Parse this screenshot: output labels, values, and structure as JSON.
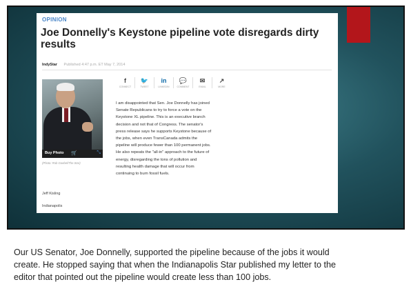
{
  "colors": {
    "slide_bg": "#21525d",
    "accent": "#b3161b",
    "opinion_label": "#4a86c8",
    "twitter": "#1da1f2",
    "linkedin": "#0e6aa8"
  },
  "article": {
    "section": "OPINION",
    "headline": "Joe Donnelly's Keystone pipeline vote disregards dirty results",
    "publisher": "IndyStar",
    "published": "Published 4:47 p.m. ET May 7, 2014",
    "share": [
      {
        "icon": "facebook-icon",
        "glyph": "f",
        "label": "CONNECT"
      },
      {
        "icon": "twitter-icon",
        "glyph": "🐦",
        "label": "TWEET"
      },
      {
        "icon": "linkedin-icon",
        "glyph": "in",
        "label": "LINKEDIN"
      },
      {
        "icon": "comment-icon",
        "glyph": "💬",
        "label": "COMMENT"
      },
      {
        "icon": "email-icon",
        "glyph": "✉",
        "label": "EMAIL"
      },
      {
        "icon": "more-icon",
        "glyph": "↗",
        "label": "MORE"
      }
    ],
    "photo": {
      "buy_label": "Buy Photo",
      "caption": "(Photo: Rob Goebel/The Star)"
    },
    "body_lines": [
      "I am disappointed that Sen. Joe Donnelly has joined",
      "Senate Republicans to try to force a vote on the",
      "Keystone XL pipeline. This is an executive branch",
      "decision and not that of Congress. The senator's",
      "press release says he supports Keystone because of",
      "the jobs, when even TransCanada admits the",
      "pipeline will produce fewer than 100 permanent jobs.",
      "He also repeats the \"all-in\" approach to the future of",
      "energy, disregarding the tons of pollution and",
      "resulting health damage that will occur from",
      "continuing to burn fossil fuels."
    ],
    "author": "Jeff Kisling",
    "city": "Indianapolis"
  },
  "note": {
    "lines": [
      "Our US Senator, Joe Donnelly, supported the pipeline because of the jobs it would",
      "create. He stopped saying that when the Indianapolis Star published my letter to the",
      "editor that pointed out the pipeline would create less than 100 jobs."
    ]
  }
}
